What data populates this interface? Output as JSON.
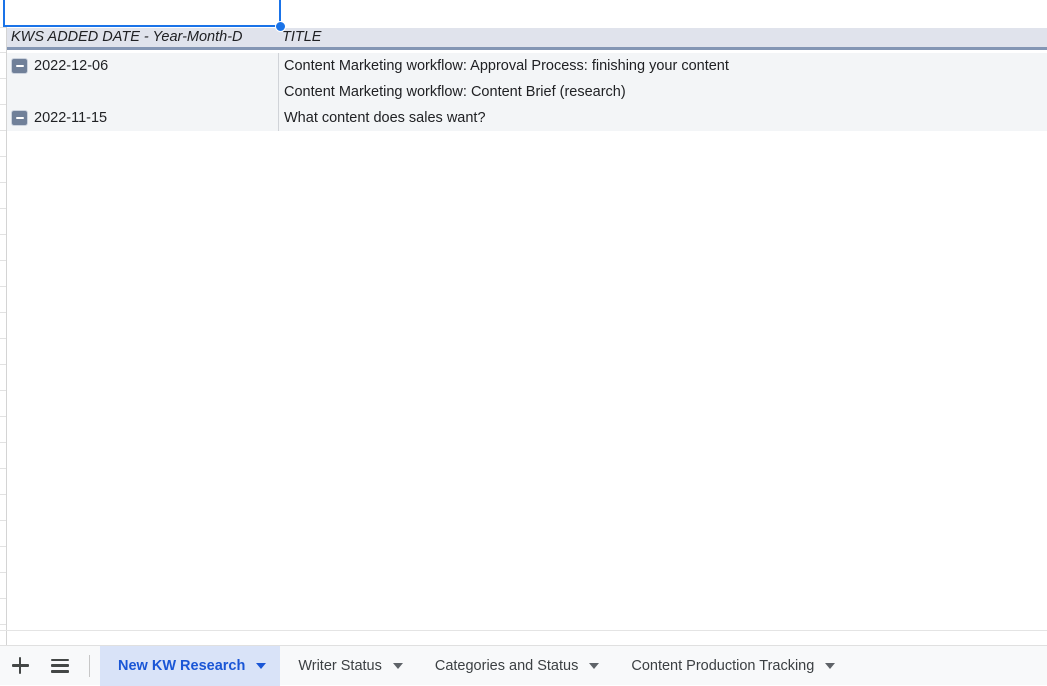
{
  "grid": {
    "selected_cell": {
      "value": ""
    },
    "columns": [
      {
        "id": "date",
        "header": "KWS ADDED DATE - Year-Month-D"
      },
      {
        "id": "title",
        "header": "TITLE"
      }
    ],
    "rows": [
      {
        "toggle": true,
        "date": "2022-12-06",
        "title": "Content Marketing workflow: Approval Process: finishing your content"
      },
      {
        "toggle": false,
        "date": "",
        "title": "Content Marketing workflow: Content Brief (research)"
      },
      {
        "toggle": true,
        "date": "2022-11-15",
        "title": "What content does sales want?"
      }
    ]
  },
  "sheet_bar": {
    "add_sheet_label": "+",
    "add_sheet_icon": "plus-icon",
    "all_sheets_icon": "hamburger-menu-icon",
    "tabs": [
      {
        "label": "New KW Research",
        "active": true
      },
      {
        "label": "Writer Status",
        "active": false
      },
      {
        "label": "Categories and Status",
        "active": false
      },
      {
        "label": "Content Production Tracking",
        "active": false
      }
    ]
  },
  "colors": {
    "selection_blue": "#1a73e8",
    "header_band": "#e0e3ec",
    "header_rule": "#8496b4",
    "data_band": "#f3f5f7",
    "active_tab_bg": "#d9e3f8",
    "active_tab_text": "#1a56d6",
    "group_toggle": "#708099"
  }
}
